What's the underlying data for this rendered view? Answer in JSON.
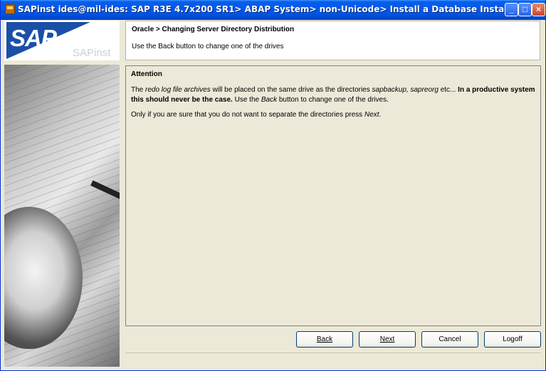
{
  "window": {
    "title": "SAPinst ides@mil-ides: SAP R3E 4.7x200 SR1> ABAP System> non-Unicode> Install a Database Instance"
  },
  "logo": {
    "brand": "SAP",
    "product": "SAPinst"
  },
  "header": {
    "title": "Oracle > Changing Server Directory Distribution",
    "subtitle": "Use the Back button to change one of the drives"
  },
  "content": {
    "heading": "Attention",
    "p1_a": "The ",
    "p1_b": "redo log file archives",
    "p1_c": " will be placed on the same drive as the directories ",
    "p1_d": "sapbackup, sapreorg",
    "p1_e": " etc... ",
    "p1_f": "In a productive system this should never be the case.",
    "p1_g": " Use the ",
    "p1_h": "Back",
    "p1_i": " button to change one of the drives.",
    "p2_a": "Only if you are sure that you do not want to separate the directories press ",
    "p2_b": "Next",
    "p2_c": "."
  },
  "buttons": {
    "back": "Back",
    "next": "Next",
    "cancel": "Cancel",
    "logoff": "Logoff"
  },
  "icons": {
    "app": "sapinst-app-icon",
    "minimize": "minimize-icon",
    "maximize": "maximize-icon",
    "close": "close-icon"
  }
}
